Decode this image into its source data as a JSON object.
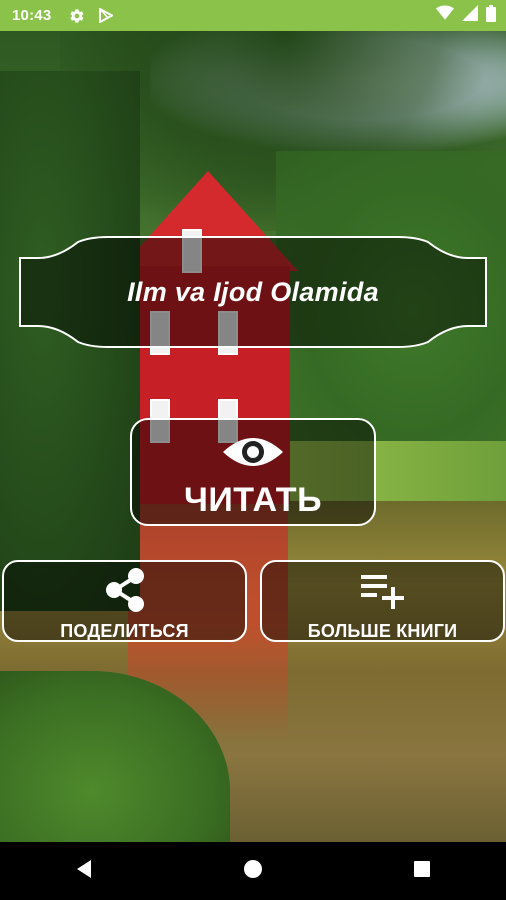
{
  "status_bar": {
    "time": "10:43",
    "icons": [
      "settings-gear-icon",
      "play-store-icon",
      "wifi-icon",
      "signal-icon",
      "battery-icon"
    ],
    "background_color": "#8bc34a"
  },
  "main": {
    "title": "Ilm va Ijod Olamida",
    "read_button": {
      "label": "ЧИТАТЬ",
      "icon": "eye-icon"
    },
    "share_button": {
      "label": "ПОДЕЛИТЬСЯ",
      "icon": "share-icon"
    },
    "more_books_button": {
      "label": "БОЛЬШЕ КНИГИ",
      "icon": "playlist-add-icon"
    }
  },
  "nav_bar": {
    "buttons": [
      "back-icon",
      "home-icon",
      "recents-icon"
    ]
  }
}
